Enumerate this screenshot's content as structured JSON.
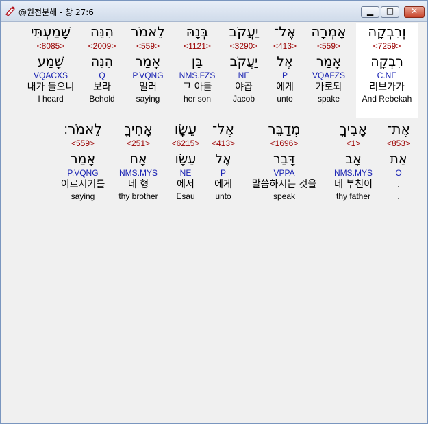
{
  "window": {
    "title": "@원전분해 - 창 27:6"
  },
  "icons": {
    "app": "scroll-icon",
    "minimize": "minimize-icon",
    "maximize": "maximize-icon",
    "close": "close-icon"
  },
  "rows": [
    {
      "words": [
        {
          "hebrew": "וְרִבְקָה",
          "strong": "<7259>",
          "lemma": "רִבְקָה",
          "morph": "C.NE",
          "korean": "리브가가",
          "english": "And Rebekah",
          "selected": true
        },
        {
          "hebrew": "אָמְרָה",
          "strong": "<559>",
          "lemma": "אָמַר",
          "morph": "VQAFZS",
          "korean": "가로되",
          "english": "spake"
        },
        {
          "hebrew": "אֶל־",
          "strong": "<413>",
          "lemma": "אֶל",
          "morph": "P",
          "korean": "에게",
          "english": "unto"
        },
        {
          "hebrew": "יַעֲקֹב",
          "strong": "<3290>",
          "lemma": "יַעֲקֹב",
          "morph": "NE",
          "korean": "야곱",
          "english": "Jacob"
        },
        {
          "hebrew": "בְּנָהּ",
          "strong": "<1121>",
          "lemma": "בֵּן",
          "morph": "NMS.FZS",
          "korean": "그 아들",
          "english": "her son"
        },
        {
          "hebrew": "הִנֵּה",
          "strong": "<2009>",
          "lemma": "הִנֵּה",
          "morph": "Q",
          "korean": "보라",
          "english": "Behold"
        },
        {
          "hebrew": "לֵאמֹר",
          "strong": "<559>",
          "lemma": "אָמַר",
          "morph": "P.VQNG",
          "korean": "일러",
          "english": "saying"
        },
        {
          "hebrew": "שָׁמַעְתִּי",
          "strong": "<8085>",
          "lemma": "שָׁמַע",
          "morph": "VQACXS",
          "korean": "내가 들으니",
          "english": "I heard"
        }
      ]
    },
    {
      "words": [
        {
          "hebrew": "אֶת־",
          "strong": "<853>",
          "lemma": "אֵת",
          "morph": "O",
          "korean": ".",
          "english": "."
        },
        {
          "hebrew": "אָבִיךָ",
          "strong": "<1>",
          "lemma": "אָב",
          "morph": "NMS.MYS",
          "korean": "네 부친이",
          "english": "thy father"
        },
        {
          "hebrew": "מְדַבֵּר",
          "strong": "<1696>",
          "lemma": "דָּבַר",
          "morph": "VPPA",
          "korean": "말씀하시는 것을",
          "english": "speak"
        },
        {
          "hebrew": "אֶל־",
          "strong": "<413>",
          "lemma": "אֶל",
          "morph": "P",
          "korean": "에게",
          "english": "unto"
        },
        {
          "hebrew": "עֵשָׂו",
          "strong": "<6215>",
          "lemma": "עֵשָׂו",
          "morph": "NE",
          "korean": "에서",
          "english": "Esau"
        },
        {
          "hebrew": "אָחִיךָ",
          "strong": "<251>",
          "lemma": "אָח",
          "morph": "NMS.MYS",
          "korean": "네 형",
          "english": "thy brother"
        },
        {
          "hebrew": "לֵאמֹר׃",
          "strong": "<559>",
          "lemma": "אָמַר",
          "morph": "P.VQNG",
          "korean": "이르시기를",
          "english": "saying"
        }
      ]
    }
  ]
}
